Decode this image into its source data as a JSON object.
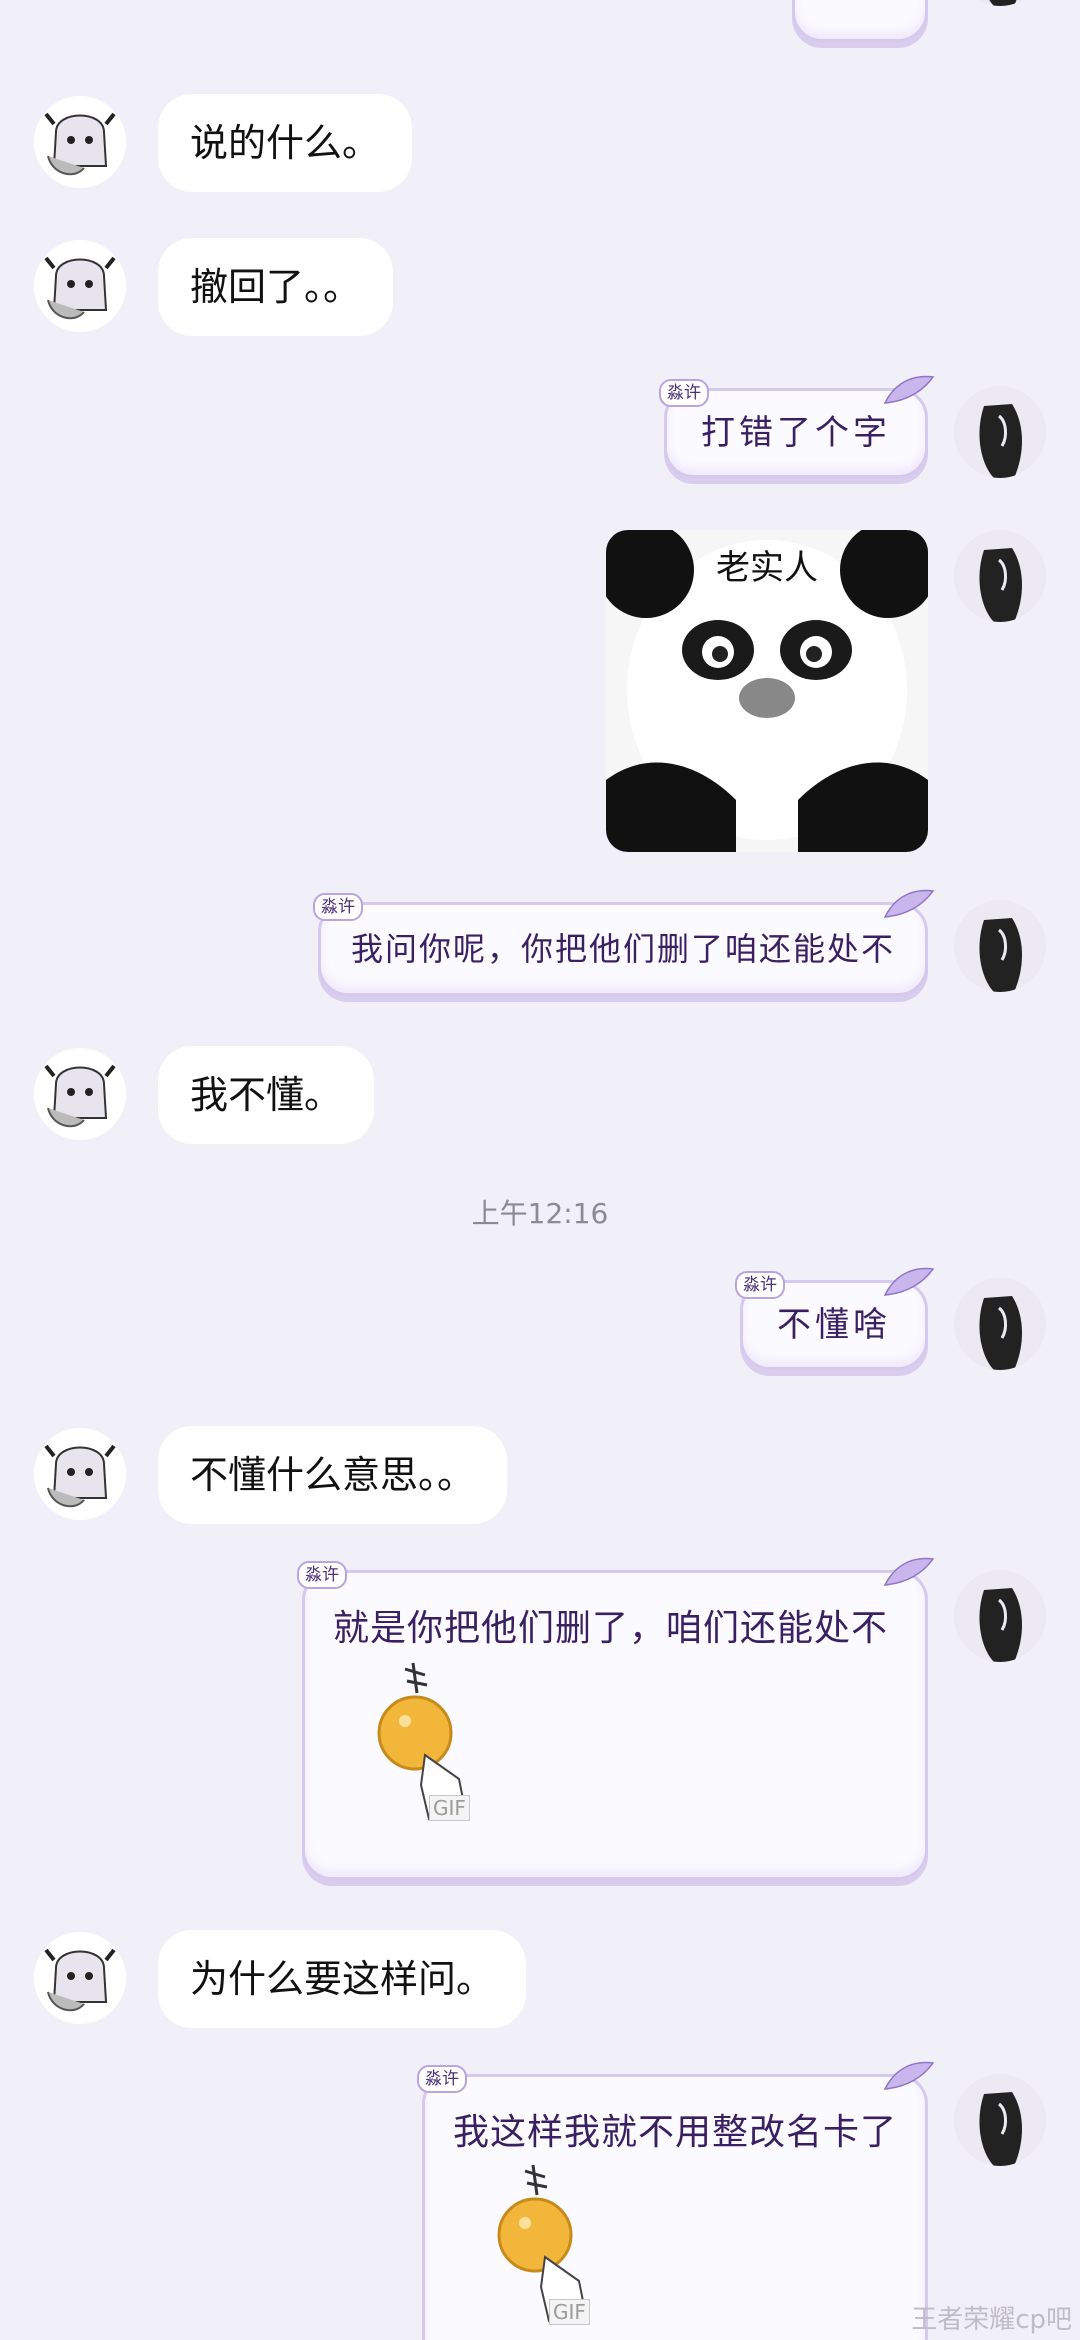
{
  "contacts": {
    "self_tag": "淼许"
  },
  "messages": [
    {
      "side": "left",
      "text": "说的什么。"
    },
    {
      "side": "left",
      "text": "撤回了。。"
    },
    {
      "side": "right",
      "text": "打错了个字"
    },
    {
      "side": "right",
      "type": "image",
      "caption": "老实人"
    },
    {
      "side": "right",
      "text": "我问你呢，你把他们删了咱还能处不"
    },
    {
      "side": "left",
      "text": "我不懂。"
    },
    {
      "type": "timestamp",
      "text": "上午12:16"
    },
    {
      "side": "right",
      "text": "不懂啥"
    },
    {
      "side": "left",
      "text": "不懂什么意思。。"
    },
    {
      "side": "right",
      "text": "就是你把他们删了，咱们还能处不",
      "sticker": "GIF"
    },
    {
      "side": "left",
      "text": "为什么要这样问。"
    },
    {
      "side": "right",
      "text": "我这样我就不用整改名卡了",
      "sticker": "GIF"
    }
  ],
  "watermark": "王者荣耀cp吧",
  "colors": {
    "background": "#f1eff8",
    "left_bubble": "#ffffff",
    "right_bubble_border": "#d6c9ee",
    "right_text": "#3a1f62"
  },
  "icons": {
    "left_avatar": "anime-girl-avatar",
    "right_avatar": "dark-hair-avatar",
    "bubble_decoration": "feather-icon"
  }
}
